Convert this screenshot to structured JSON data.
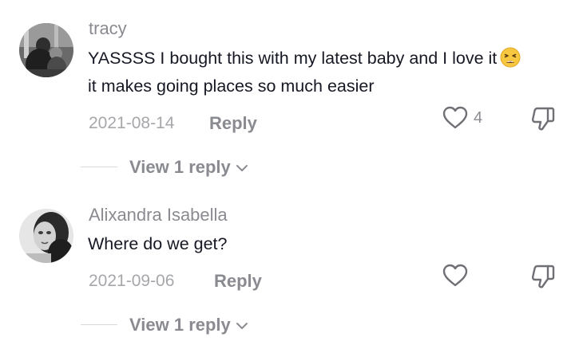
{
  "comments": [
    {
      "username": "tracy",
      "text_line1": "YASSSS I bought this with my latest baby and I love it",
      "emoji": "weary-face",
      "text_line2": "it makes going places so much easier",
      "date": "2021-08-14",
      "reply_label": "Reply",
      "like_count": "4",
      "view_replies_label": "View 1 reply"
    },
    {
      "username": "Alixandra Isabella",
      "text_line1": "Where do we get?",
      "date": "2021-09-06",
      "reply_label": "Reply",
      "view_replies_label": "View 1 reply"
    }
  ],
  "icons": {
    "like": "heart-outline-icon",
    "dislike": "thumbs-down-icon",
    "expand": "chevron-down-icon"
  },
  "colors": {
    "primary_text": "#161823",
    "secondary_text": "#8a8b91",
    "date_text": "#a6a7ab",
    "icon": "#6f7075"
  }
}
